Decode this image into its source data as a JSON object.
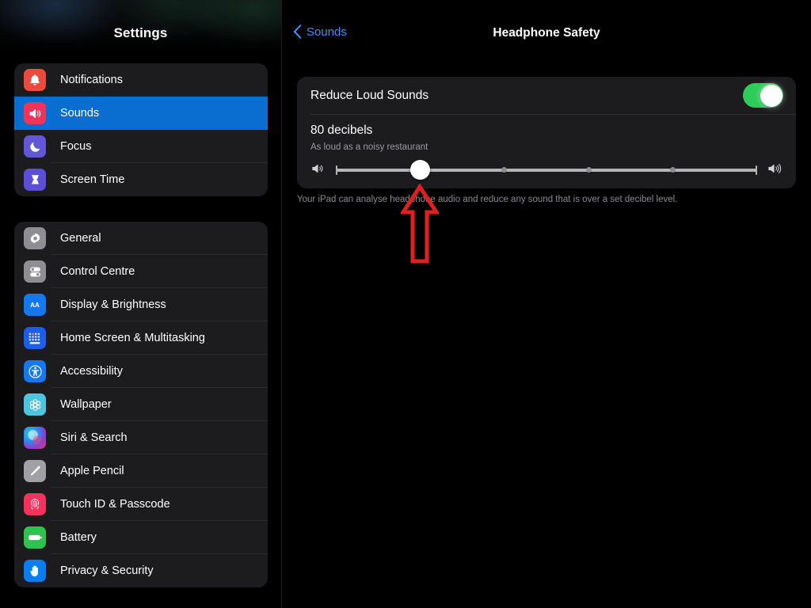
{
  "sidebar": {
    "title": "Settings",
    "groups": [
      {
        "items": [
          {
            "label": "Notifications",
            "icon": "bell-icon",
            "icon_bg": "#eb4b3c",
            "selected": false
          },
          {
            "label": "Sounds",
            "icon": "speaker-waves-icon",
            "icon_bg": "#f4335c",
            "selected": true
          },
          {
            "label": "Focus",
            "icon": "moon-icon",
            "icon_bg": "#6257d7",
            "selected": false
          },
          {
            "label": "Screen Time",
            "icon": "hourglass-icon",
            "icon_bg": "#5b4fd6",
            "selected": false
          }
        ]
      },
      {
        "items": [
          {
            "label": "General",
            "icon": "gear-icon",
            "icon_bg": "#8e8e93",
            "selected": false
          },
          {
            "label": "Control Centre",
            "icon": "toggles-icon",
            "icon_bg": "#8e8e93",
            "selected": false
          },
          {
            "label": "Display & Brightness",
            "icon": "aa-text-icon",
            "icon_bg": "#1478f0",
            "selected": false
          },
          {
            "label": "Home Screen & Multitasking",
            "icon": "home-grid-icon",
            "icon_bg": "#1c5ee8",
            "selected": false
          },
          {
            "label": "Accessibility",
            "icon": "accessibility-icon",
            "icon_bg": "#1478f0",
            "selected": false
          },
          {
            "label": "Wallpaper",
            "icon": "flower-icon",
            "icon_bg": "#4fc4e0",
            "selected": false
          },
          {
            "label": "Siri & Search",
            "icon": "siri-orb-icon",
            "icon_bg": "#8b3fd0",
            "selected": false
          },
          {
            "label": "Apple Pencil",
            "icon": "pencil-icon",
            "icon_bg": "#a0a0a5",
            "selected": false
          },
          {
            "label": "Touch ID & Passcode",
            "icon": "fingerprint-icon",
            "icon_bg": "#f4335c",
            "selected": false
          },
          {
            "label": "Battery",
            "icon": "battery-icon",
            "icon_bg": "#30c24e",
            "selected": false
          },
          {
            "label": "Privacy & Security",
            "icon": "hand-icon",
            "icon_bg": "#0a7df0",
            "selected": false
          }
        ]
      }
    ]
  },
  "detail": {
    "back_label": "Sounds",
    "title": "Headphone Safety",
    "reduce_loud_sounds_label": "Reduce Loud Sounds",
    "toggle_state": "on",
    "decibel_value": "80 decibels",
    "decibel_description": "As loud as a noisy restaurant",
    "footnote": "Your iPad can analyse headphone audio and reduce any sound that is over a set decibel level.",
    "slider": {
      "value_percent": 20,
      "tick_percents": [
        40,
        60,
        80
      ],
      "low_icon": "speaker-low-icon",
      "high_icon": "speaker-high-icon"
    }
  },
  "annotation": {
    "arrow": "red-up-arrow",
    "color": "#e02020"
  },
  "colors": {
    "accent_blue": "#0a6ed1",
    "link_blue": "#4a8cf7",
    "toggle_green": "#2ecc58",
    "card_bg": "#1c1c1e",
    "page_bg": "#000000"
  }
}
